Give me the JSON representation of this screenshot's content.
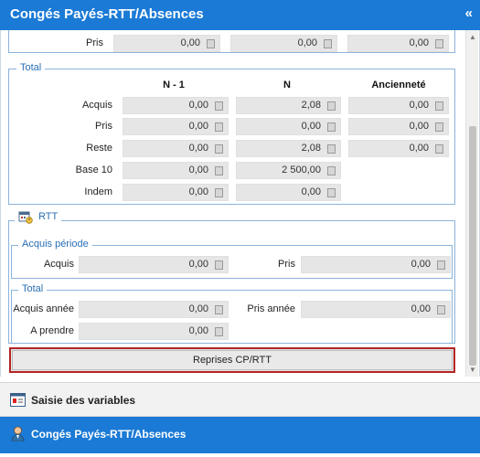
{
  "header": {
    "title": "Congés Payés-RTT/Absences",
    "collapse_glyph": "«"
  },
  "pris_top": {
    "label": "Pris",
    "values": [
      "0,00",
      "0,00",
      "0,00"
    ]
  },
  "total": {
    "legend": "Total",
    "columns": [
      "N - 1",
      "N",
      "Ancienneté"
    ],
    "rows": [
      {
        "label": "Acquis",
        "values": [
          "0,00",
          "2,08",
          "0,00"
        ]
      },
      {
        "label": "Pris",
        "values": [
          "0,00",
          "0,00",
          "0,00"
        ]
      },
      {
        "label": "Reste",
        "values": [
          "0,00",
          "2,08",
          "0,00"
        ]
      },
      {
        "label": "Base 10",
        "values": [
          "0,00",
          "2 500,00"
        ]
      },
      {
        "label": "Indem",
        "values": [
          "0,00",
          "0,00"
        ]
      }
    ]
  },
  "rtt": {
    "legend": "RTT",
    "acquis_periode": {
      "legend": "Acquis période",
      "acquis_label": "Acquis",
      "acquis_value": "0,00",
      "pris_label": "Pris",
      "pris_value": "0,00"
    },
    "total": {
      "legend": "Total",
      "acquis_annee_label": "Acquis année",
      "acquis_annee_value": "0,00",
      "pris_annee_label": "Pris année",
      "pris_annee_value": "0,00",
      "a_prendre_label": "A prendre",
      "a_prendre_value": "0,00"
    }
  },
  "reprises_button": "Reprises CP/RTT",
  "nav": [
    {
      "label": "Saisie des variables",
      "icon": "form-icon"
    },
    {
      "label": "Congés Payés-RTT/Absences",
      "icon": "person-icon"
    }
  ],
  "colors": {
    "header_bg": "#1a7ad6",
    "groupbox_border": "#8cb3d9",
    "highlight_border": "#b42424"
  }
}
